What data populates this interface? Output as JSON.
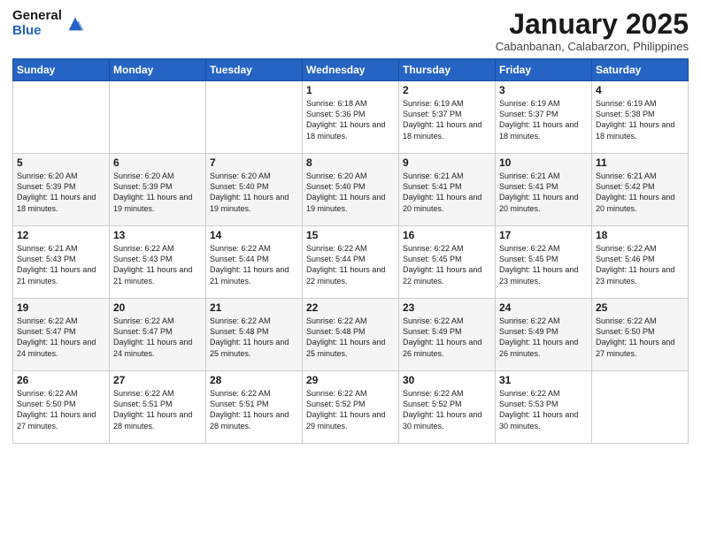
{
  "logo": {
    "general": "General",
    "blue": "Blue"
  },
  "header": {
    "month": "January 2025",
    "location": "Cabanbanan, Calabarzon, Philippines"
  },
  "weekdays": [
    "Sunday",
    "Monday",
    "Tuesday",
    "Wednesday",
    "Thursday",
    "Friday",
    "Saturday"
  ],
  "weeks": [
    [
      {
        "day": "",
        "sunrise": "",
        "sunset": "",
        "daylight": ""
      },
      {
        "day": "",
        "sunrise": "",
        "sunset": "",
        "daylight": ""
      },
      {
        "day": "",
        "sunrise": "",
        "sunset": "",
        "daylight": ""
      },
      {
        "day": "1",
        "sunrise": "Sunrise: 6:18 AM",
        "sunset": "Sunset: 5:36 PM",
        "daylight": "Daylight: 11 hours and 18 minutes."
      },
      {
        "day": "2",
        "sunrise": "Sunrise: 6:19 AM",
        "sunset": "Sunset: 5:37 PM",
        "daylight": "Daylight: 11 hours and 18 minutes."
      },
      {
        "day": "3",
        "sunrise": "Sunrise: 6:19 AM",
        "sunset": "Sunset: 5:37 PM",
        "daylight": "Daylight: 11 hours and 18 minutes."
      },
      {
        "day": "4",
        "sunrise": "Sunrise: 6:19 AM",
        "sunset": "Sunset: 5:38 PM",
        "daylight": "Daylight: 11 hours and 18 minutes."
      }
    ],
    [
      {
        "day": "5",
        "sunrise": "Sunrise: 6:20 AM",
        "sunset": "Sunset: 5:39 PM",
        "daylight": "Daylight: 11 hours and 18 minutes."
      },
      {
        "day": "6",
        "sunrise": "Sunrise: 6:20 AM",
        "sunset": "Sunset: 5:39 PM",
        "daylight": "Daylight: 11 hours and 19 minutes."
      },
      {
        "day": "7",
        "sunrise": "Sunrise: 6:20 AM",
        "sunset": "Sunset: 5:40 PM",
        "daylight": "Daylight: 11 hours and 19 minutes."
      },
      {
        "day": "8",
        "sunrise": "Sunrise: 6:20 AM",
        "sunset": "Sunset: 5:40 PM",
        "daylight": "Daylight: 11 hours and 19 minutes."
      },
      {
        "day": "9",
        "sunrise": "Sunrise: 6:21 AM",
        "sunset": "Sunset: 5:41 PM",
        "daylight": "Daylight: 11 hours and 20 minutes."
      },
      {
        "day": "10",
        "sunrise": "Sunrise: 6:21 AM",
        "sunset": "Sunset: 5:41 PM",
        "daylight": "Daylight: 11 hours and 20 minutes."
      },
      {
        "day": "11",
        "sunrise": "Sunrise: 6:21 AM",
        "sunset": "Sunset: 5:42 PM",
        "daylight": "Daylight: 11 hours and 20 minutes."
      }
    ],
    [
      {
        "day": "12",
        "sunrise": "Sunrise: 6:21 AM",
        "sunset": "Sunset: 5:43 PM",
        "daylight": "Daylight: 11 hours and 21 minutes."
      },
      {
        "day": "13",
        "sunrise": "Sunrise: 6:22 AM",
        "sunset": "Sunset: 5:43 PM",
        "daylight": "Daylight: 11 hours and 21 minutes."
      },
      {
        "day": "14",
        "sunrise": "Sunrise: 6:22 AM",
        "sunset": "Sunset: 5:44 PM",
        "daylight": "Daylight: 11 hours and 21 minutes."
      },
      {
        "day": "15",
        "sunrise": "Sunrise: 6:22 AM",
        "sunset": "Sunset: 5:44 PM",
        "daylight": "Daylight: 11 hours and 22 minutes."
      },
      {
        "day": "16",
        "sunrise": "Sunrise: 6:22 AM",
        "sunset": "Sunset: 5:45 PM",
        "daylight": "Daylight: 11 hours and 22 minutes."
      },
      {
        "day": "17",
        "sunrise": "Sunrise: 6:22 AM",
        "sunset": "Sunset: 5:45 PM",
        "daylight": "Daylight: 11 hours and 23 minutes."
      },
      {
        "day": "18",
        "sunrise": "Sunrise: 6:22 AM",
        "sunset": "Sunset: 5:46 PM",
        "daylight": "Daylight: 11 hours and 23 minutes."
      }
    ],
    [
      {
        "day": "19",
        "sunrise": "Sunrise: 6:22 AM",
        "sunset": "Sunset: 5:47 PM",
        "daylight": "Daylight: 11 hours and 24 minutes."
      },
      {
        "day": "20",
        "sunrise": "Sunrise: 6:22 AM",
        "sunset": "Sunset: 5:47 PM",
        "daylight": "Daylight: 11 hours and 24 minutes."
      },
      {
        "day": "21",
        "sunrise": "Sunrise: 6:22 AM",
        "sunset": "Sunset: 5:48 PM",
        "daylight": "Daylight: 11 hours and 25 minutes."
      },
      {
        "day": "22",
        "sunrise": "Sunrise: 6:22 AM",
        "sunset": "Sunset: 5:48 PM",
        "daylight": "Daylight: 11 hours and 25 minutes."
      },
      {
        "day": "23",
        "sunrise": "Sunrise: 6:22 AM",
        "sunset": "Sunset: 5:49 PM",
        "daylight": "Daylight: 11 hours and 26 minutes."
      },
      {
        "day": "24",
        "sunrise": "Sunrise: 6:22 AM",
        "sunset": "Sunset: 5:49 PM",
        "daylight": "Daylight: 11 hours and 26 minutes."
      },
      {
        "day": "25",
        "sunrise": "Sunrise: 6:22 AM",
        "sunset": "Sunset: 5:50 PM",
        "daylight": "Daylight: 11 hours and 27 minutes."
      }
    ],
    [
      {
        "day": "26",
        "sunrise": "Sunrise: 6:22 AM",
        "sunset": "Sunset: 5:50 PM",
        "daylight": "Daylight: 11 hours and 27 minutes."
      },
      {
        "day": "27",
        "sunrise": "Sunrise: 6:22 AM",
        "sunset": "Sunset: 5:51 PM",
        "daylight": "Daylight: 11 hours and 28 minutes."
      },
      {
        "day": "28",
        "sunrise": "Sunrise: 6:22 AM",
        "sunset": "Sunset: 5:51 PM",
        "daylight": "Daylight: 11 hours and 28 minutes."
      },
      {
        "day": "29",
        "sunrise": "Sunrise: 6:22 AM",
        "sunset": "Sunset: 5:52 PM",
        "daylight": "Daylight: 11 hours and 29 minutes."
      },
      {
        "day": "30",
        "sunrise": "Sunrise: 6:22 AM",
        "sunset": "Sunset: 5:52 PM",
        "daylight": "Daylight: 11 hours and 30 minutes."
      },
      {
        "day": "31",
        "sunrise": "Sunrise: 6:22 AM",
        "sunset": "Sunset: 5:53 PM",
        "daylight": "Daylight: 11 hours and 30 minutes."
      },
      {
        "day": "",
        "sunrise": "",
        "sunset": "",
        "daylight": ""
      }
    ]
  ]
}
